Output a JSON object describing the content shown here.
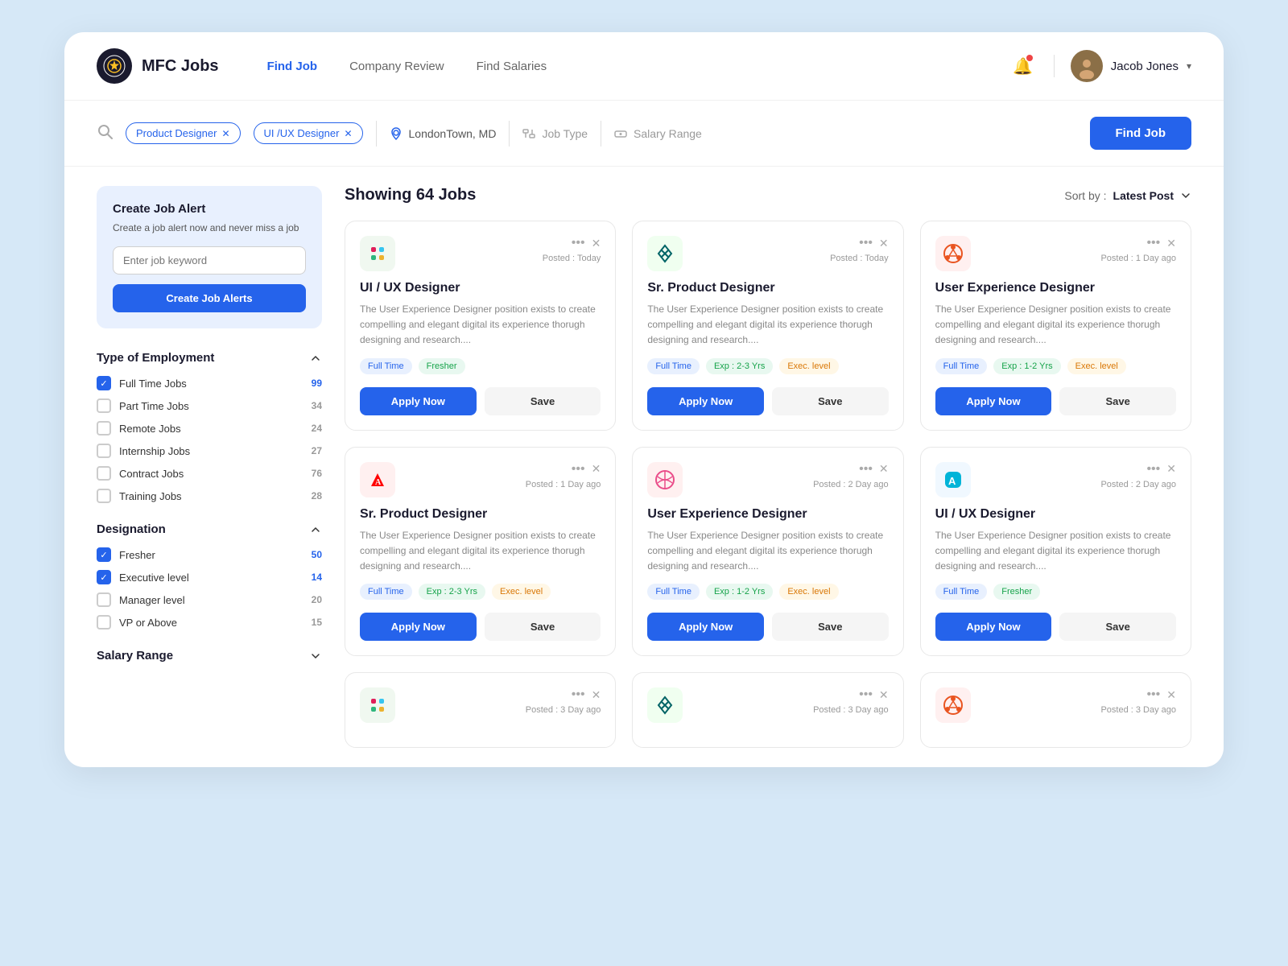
{
  "app": {
    "logo_emoji": "⚽",
    "name": "MFC Jobs"
  },
  "nav": {
    "links": [
      {
        "label": "Find Job",
        "active": true
      },
      {
        "label": "Company Review",
        "active": false
      },
      {
        "label": "Find Salaries",
        "active": false
      }
    ]
  },
  "header": {
    "bell_icon": "🔔",
    "user_avatar": "👤",
    "user_name": "Jacob Jones"
  },
  "search": {
    "tags": [
      {
        "label": "Product Designer"
      },
      {
        "label": "UI /UX Designer"
      }
    ],
    "location": "LondonTown, MD",
    "job_type_placeholder": "Job Type",
    "salary_range_placeholder": "Salary Range",
    "find_job_label": "Find Job"
  },
  "results": {
    "count": "Showing 64 Jobs",
    "sort_label": "Sort by :",
    "sort_value": "Latest Post"
  },
  "alert_card": {
    "title": "Create Job Alert",
    "desc": "Create a job alert now and never miss a job",
    "input_placeholder": "Enter job keyword",
    "button_label": "Create Job Alerts"
  },
  "filters": {
    "employment": {
      "title": "Type of Employment",
      "items": [
        {
          "label": "Full Time Jobs",
          "count": 99,
          "checked": true
        },
        {
          "label": "Part Time Jobs",
          "count": 34,
          "checked": false
        },
        {
          "label": "Remote Jobs",
          "count": 24,
          "checked": false
        },
        {
          "label": "Internship Jobs",
          "count": 27,
          "checked": false
        },
        {
          "label": "Contract Jobs",
          "count": 76,
          "checked": false
        },
        {
          "label": "Training Jobs",
          "count": 28,
          "checked": false
        }
      ]
    },
    "designation": {
      "title": "Designation",
      "items": [
        {
          "label": "Fresher",
          "count": 50,
          "checked": true
        },
        {
          "label": "Executive level",
          "count": 14,
          "checked": true
        },
        {
          "label": "Manager level",
          "count": 20,
          "checked": false
        },
        {
          "label": "VP or Above",
          "count": 15,
          "checked": false
        }
      ]
    },
    "salary": {
      "title": "Salary Range"
    }
  },
  "jobs": [
    {
      "id": 1,
      "logo_class": "logo-slack",
      "logo_emoji": "✦",
      "logo_svg": "slack",
      "posted": "Posted : Today",
      "title": "UI / UX Designer",
      "desc": "The User Experience Designer position exists to create compelling and elegant digital its experience thorugh designing and research....",
      "tags": [
        {
          "label": "Full Time",
          "class": "tag-blue"
        },
        {
          "label": "Fresher",
          "class": "tag-green"
        }
      ],
      "apply_label": "Apply Now",
      "save_label": "Save"
    },
    {
      "id": 2,
      "logo_class": "logo-xing",
      "logo_emoji": "✕",
      "logo_svg": "xing",
      "posted": "Posted : Today",
      "title": "Sr. Product Designer",
      "desc": "The User Experience Designer position exists to create compelling and elegant digital its experience thorugh designing and research....",
      "tags": [
        {
          "label": "Full Time",
          "class": "tag-blue"
        },
        {
          "label": "Exp : 2-3 Yrs",
          "class": "tag-green"
        },
        {
          "label": "Exec. level",
          "class": "tag-orange"
        }
      ],
      "apply_label": "Apply Now",
      "save_label": "Save"
    },
    {
      "id": 3,
      "logo_class": "logo-ubuntu",
      "logo_emoji": "◎",
      "logo_svg": "ubuntu",
      "posted": "Posted : 1 Day ago",
      "title": "User Experience Designer",
      "desc": "The User Experience Designer position exists to create compelling and elegant digital its experience thorugh designing and research....",
      "tags": [
        {
          "label": "Full Time",
          "class": "tag-blue"
        },
        {
          "label": "Exp : 1-2 Yrs",
          "class": "tag-green"
        },
        {
          "label": "Exec. level",
          "class": "tag-orange"
        }
      ],
      "apply_label": "Apply Now",
      "save_label": "Save"
    },
    {
      "id": 4,
      "logo_class": "logo-adobe",
      "logo_emoji": "A",
      "logo_svg": "adobe",
      "posted": "Posted : 1 Day ago",
      "title": "Sr. Product Designer",
      "desc": "The User Experience Designer position exists to create compelling and elegant digital its experience thorugh designing and research....",
      "tags": [
        {
          "label": "Full Time",
          "class": "tag-blue"
        },
        {
          "label": "Exp : 2-3 Yrs",
          "class": "tag-green"
        },
        {
          "label": "Exec. level",
          "class": "tag-orange"
        }
      ],
      "apply_label": "Apply Now",
      "save_label": "Save"
    },
    {
      "id": 5,
      "logo_class": "logo-dribbble",
      "logo_emoji": "⊕",
      "logo_svg": "dribbble",
      "posted": "Posted : 2 Day ago",
      "title": "User Experience Designer",
      "desc": "The User Experience Designer position exists to create compelling and elegant digital its experience thorugh designing and research....",
      "tags": [
        {
          "label": "Full Time",
          "class": "tag-blue"
        },
        {
          "label": "Exp : 1-2 Yrs",
          "class": "tag-green"
        },
        {
          "label": "Exec. level",
          "class": "tag-orange"
        }
      ],
      "apply_label": "Apply Now",
      "save_label": "Save"
    },
    {
      "id": 6,
      "logo_class": "logo-altstore",
      "logo_emoji": "⊞",
      "logo_svg": "altstore",
      "posted": "Posted : 2 Day ago",
      "title": "UI / UX Designer",
      "desc": "The User Experience Designer position exists to create compelling and elegant digital its experience thorugh designing and research....",
      "tags": [
        {
          "label": "Full Time",
          "class": "tag-blue"
        },
        {
          "label": "Fresher",
          "class": "tag-green"
        }
      ],
      "apply_label": "Apply Now",
      "save_label": "Save"
    },
    {
      "id": 7,
      "logo_class": "logo-slack",
      "logo_emoji": "✦",
      "posted": "Posted : 3 Day ago",
      "title": "",
      "desc": "",
      "tags": [],
      "apply_label": "",
      "save_label": "",
      "partial": true
    },
    {
      "id": 8,
      "logo_class": "logo-xing",
      "logo_emoji": "✕",
      "posted": "Posted : 3 Day ago",
      "title": "",
      "desc": "",
      "tags": [],
      "apply_label": "",
      "save_label": "",
      "partial": true
    },
    {
      "id": 9,
      "logo_class": "logo-ubuntu",
      "logo_emoji": "◎",
      "posted": "Posted : 3 Day ago",
      "title": "",
      "desc": "",
      "tags": [],
      "apply_label": "",
      "save_label": "",
      "partial": true
    }
  ]
}
